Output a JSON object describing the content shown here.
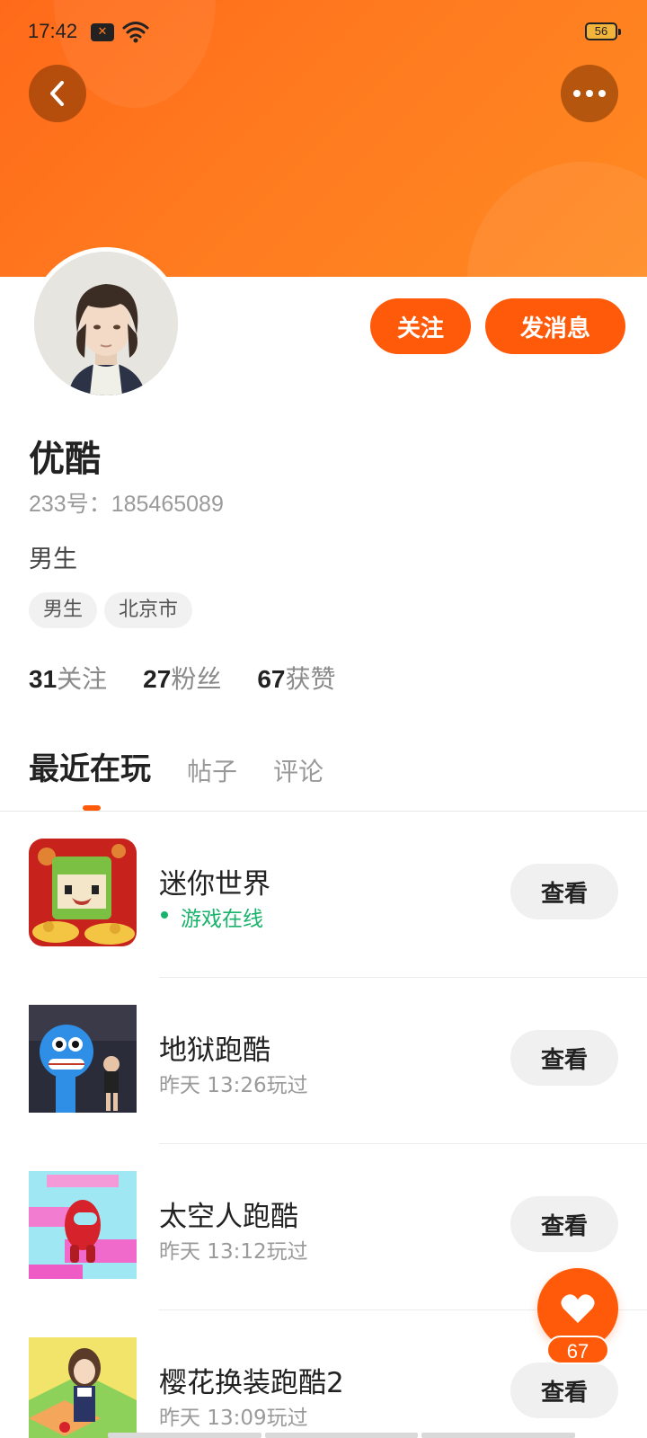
{
  "status_bar": {
    "time": "17:42",
    "battery": "56",
    "notif_icon": "x-notification-icon",
    "wifi_icon": "wifi-icon"
  },
  "header": {
    "back_icon": "chevron-left-icon",
    "more_icon": "more-dots-icon"
  },
  "actions": {
    "follow_label": "关注",
    "message_label": "发消息"
  },
  "profile": {
    "name": "优酷",
    "id_text": "233号：185465089",
    "bio": "男生",
    "tags": [
      "男生",
      "北京市"
    ]
  },
  "stats": [
    {
      "num": "31",
      "label": "关注"
    },
    {
      "num": "27",
      "label": "粉丝"
    },
    {
      "num": "67",
      "label": "获赞"
    }
  ],
  "tabs": [
    {
      "label": "最近在玩",
      "active": true
    },
    {
      "label": "帖子",
      "active": false
    },
    {
      "label": "评论",
      "active": false
    }
  ],
  "games": [
    {
      "title": "迷你世界",
      "sub": "游戏在线",
      "online": true,
      "button": "查看"
    },
    {
      "title": "地狱跑酷",
      "sub": "昨天 13:26玩过",
      "online": false,
      "button": "查看"
    },
    {
      "title": "太空人跑酷",
      "sub": "昨天 13:12玩过",
      "online": false,
      "button": "查看"
    },
    {
      "title": "樱花换装跑酷2",
      "sub": "昨天 13:09玩过",
      "online": false,
      "button": "查看"
    }
  ],
  "like_fab": {
    "icon": "heart-icon",
    "count": "67"
  },
  "colors": {
    "accent": "#ff5a0a",
    "banner": "#ff7a1f",
    "online": "#19b36b"
  }
}
